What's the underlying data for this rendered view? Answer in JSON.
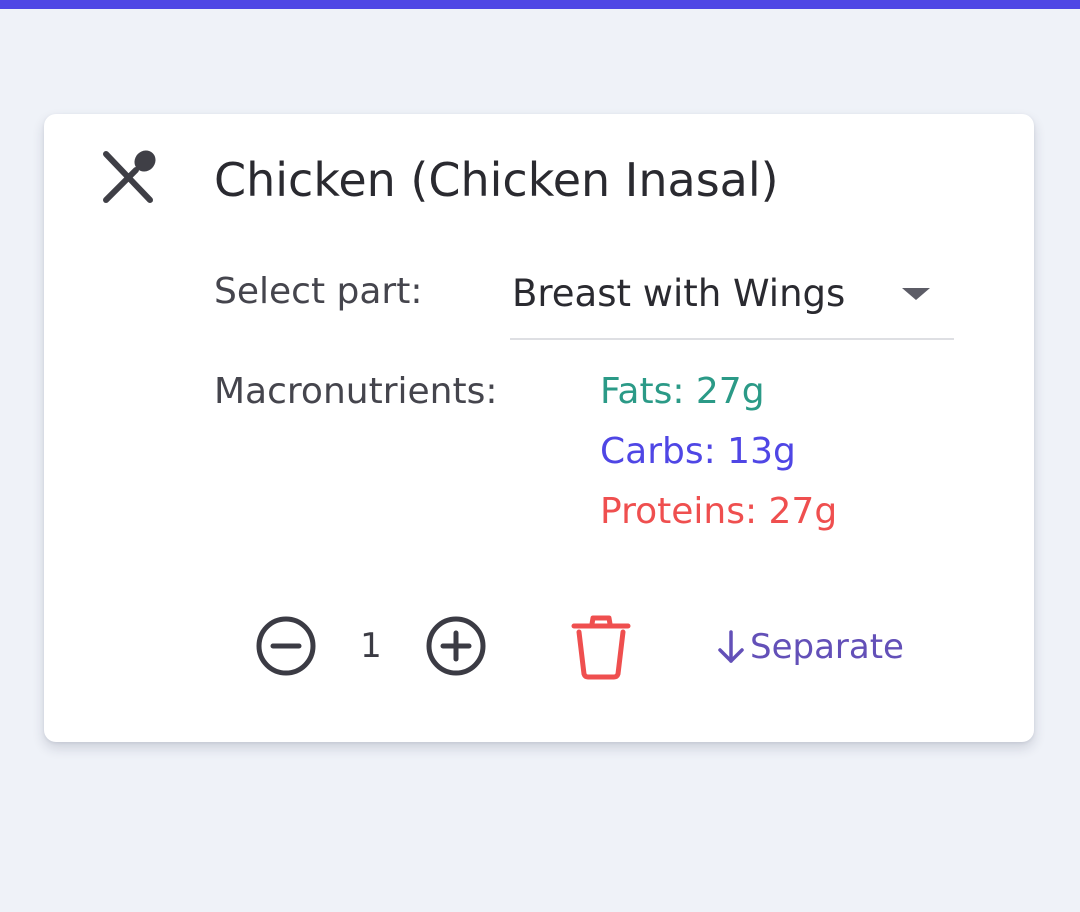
{
  "card": {
    "icon": "fork-spoon-icon",
    "title": "Chicken (Chicken Inasal)",
    "part": {
      "label": "Select part:",
      "selected": "Breast with Wings"
    },
    "macros": {
      "label": "Macronutrients:",
      "fats": "Fats: 27g",
      "carbs": "Carbs: 13g",
      "proteins": "Proteins: 27g"
    },
    "quantity": "1",
    "separate_label": "Separate"
  },
  "colors": {
    "accent": "#4f46e5",
    "fats": "#2b9a87",
    "carbs": "#4f46e5",
    "proteins": "#ef4f4f",
    "delete": "#ef4f4f",
    "separate": "#6350b8",
    "background": "#eff2f8"
  }
}
